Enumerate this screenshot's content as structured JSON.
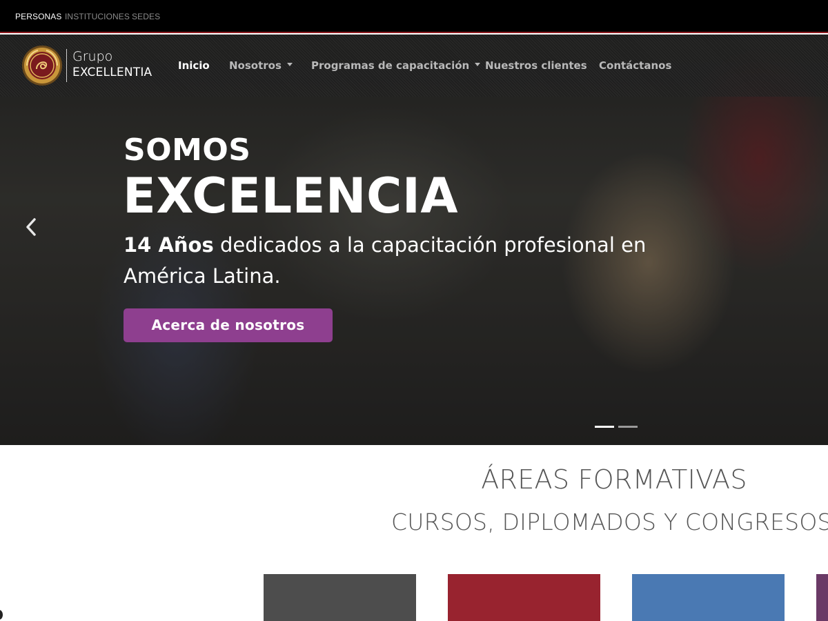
{
  "topbar": {
    "links": [
      "PERSONAS",
      "INSTITUCIONES",
      "SEDES"
    ]
  },
  "logo": {
    "line1": "Grupo",
    "line2": "EXCELLENTIA"
  },
  "nav": {
    "items": [
      "Inicio",
      "Nosotros",
      "Programas de capacitación",
      "Nuestros clientes",
      "Contáctanos"
    ],
    "active_index": 0
  },
  "hero": {
    "heading_small": "SOMOS",
    "heading_large": "EXCELENCIA",
    "subtitle_bold": "14 Años",
    "subtitle_rest": " dedicados a la capacitación profesional en América Latina.",
    "button_label": "Acerca de nosotros",
    "slides_total": 2,
    "active_slide": 1
  },
  "areas": {
    "title": "ÁREAS FORMATIVAS",
    "subtitle": "CURSOS, DIPLOMADOS Y CONGRESOS"
  },
  "colors": {
    "accent_purple": "#8e3f8f",
    "topbar_border": "#8b1a1f",
    "card_colors": [
      "#4d4d4d",
      "#98232f",
      "#4a79b3",
      "#6a3a66"
    ]
  }
}
